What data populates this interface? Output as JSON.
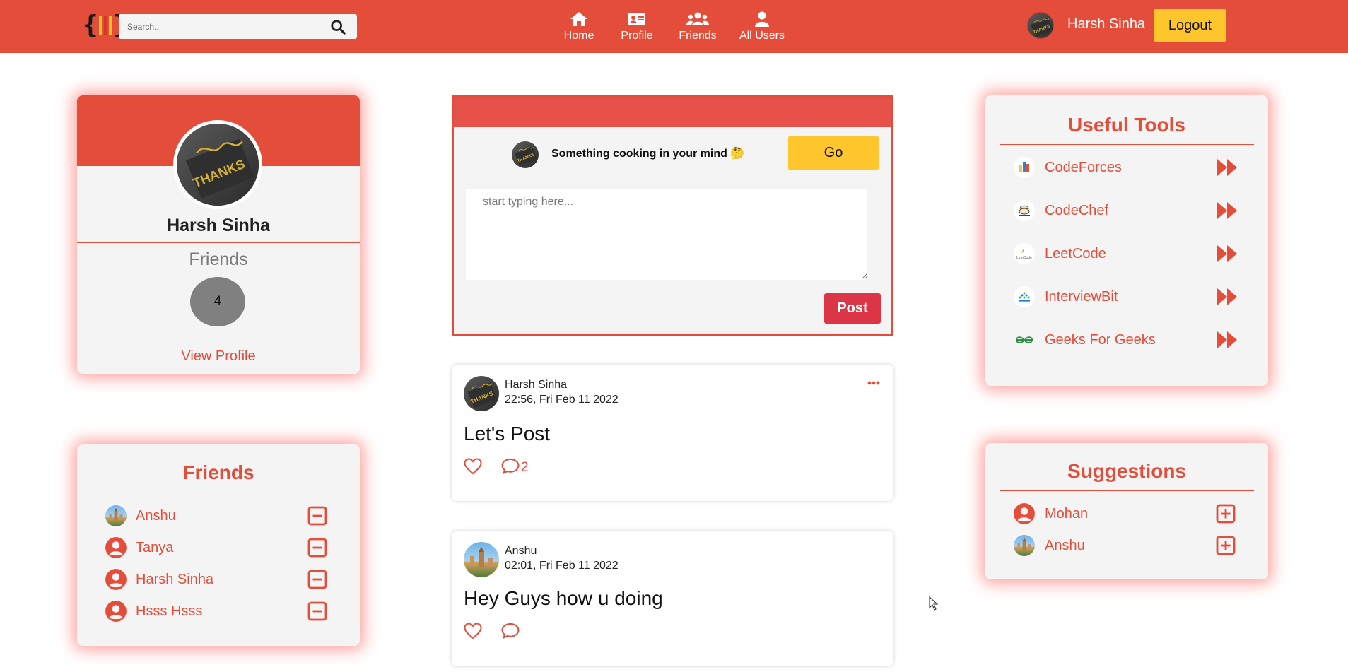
{
  "navbar": {
    "search": {
      "placeholder": "Search...",
      "value": ""
    },
    "links": [
      {
        "label": "Home",
        "icon": "home-icon"
      },
      {
        "label": "Profile",
        "icon": "id-card-icon"
      },
      {
        "label": "Friends",
        "icon": "users-icon"
      },
      {
        "label": "All Users",
        "icon": "user-icon"
      }
    ],
    "username": "Harsh Sinha",
    "logout_label": "Logout"
  },
  "profile_card": {
    "avatar_text": "THANKS",
    "name": "Harsh Sinha",
    "friends_label": "Friends",
    "friends_count": "4",
    "view_profile_label": "View Profile"
  },
  "friends_list": {
    "title": "Friends",
    "items": [
      {
        "name": "Anshu",
        "avatar": "photo"
      },
      {
        "name": "Tanya",
        "avatar": "user-circle-icon"
      },
      {
        "name": "Harsh Sinha",
        "avatar": "user-circle-icon"
      },
      {
        "name": "Hsss Hsss",
        "avatar": "user-circle-icon"
      }
    ]
  },
  "composer": {
    "prompt": "Something cooking in your mind 🤔",
    "go_label": "Go",
    "textarea_placeholder": "start typing here...",
    "post_label": "Post"
  },
  "posts": [
    {
      "author": "Harsh Sinha",
      "time": "22:56, Fri Feb 11 2022",
      "body": "Let's Post",
      "comment_count": "2",
      "show_menu": true
    },
    {
      "author": "Anshu",
      "time": "02:01, Fri Feb 11 2022",
      "body": "Hey Guys how u doing",
      "comment_count": "",
      "show_menu": false
    }
  ],
  "tools": {
    "title": "Useful Tools",
    "items": [
      {
        "name": "CodeForces",
        "icon": "codeforces-logo-icon"
      },
      {
        "name": "CodeChef",
        "icon": "codechef-logo-icon"
      },
      {
        "name": "LeetCode",
        "icon": "leetcode-logo-icon"
      },
      {
        "name": "InterviewBit",
        "icon": "interviewbit-logo-icon"
      },
      {
        "name": "Geeks For Geeks",
        "icon": "geeksforgeeks-logo-icon"
      }
    ]
  },
  "suggestions": {
    "title": "Suggestions",
    "items": [
      {
        "name": "Mohan",
        "avatar": "user-circle-icon"
      },
      {
        "name": "Anshu",
        "avatar": "photo"
      }
    ]
  },
  "colors": {
    "brand": "#e44d3a",
    "accent_yellow": "#fec62c",
    "post_button": "#dc3545",
    "card_bg": "#f4f4f4"
  }
}
